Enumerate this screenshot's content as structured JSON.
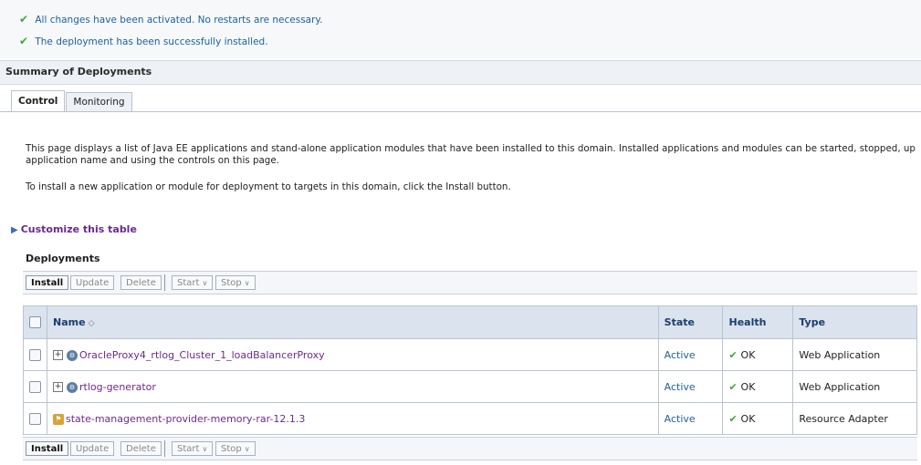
{
  "messages": [
    "All changes have been activated. No restarts are necessary.",
    "The deployment has been successfully installed."
  ],
  "summary": {
    "title": "Summary of Deployments",
    "tabs": [
      "Control",
      "Monitoring"
    ],
    "active_tab": "Control"
  },
  "description": {
    "line1": "This page displays a list of Java EE applications and stand-alone application modules that have been installed to this domain. Installed applications and modules can be started, stopped, up",
    "line1b": "application name and using the controls on this page.",
    "line2": "To install a new application or module for deployment to targets in this domain, click the Install button."
  },
  "customize": {
    "label": "Customize this table"
  },
  "deployments": {
    "title": "Deployments",
    "toolbar": {
      "install": "Install",
      "update": "Update",
      "delete": "Delete",
      "start": "Start",
      "stop": "Stop"
    },
    "columns": [
      "Name",
      "State",
      "Health",
      "Type"
    ],
    "rows": [
      {
        "name": "OracleProxy4_rtlog_Cluster_1_loadBalancerProxy",
        "state": "Active",
        "health": "OK",
        "type": "Web Application"
      },
      {
        "name": "rtlog-generator",
        "state": "Active",
        "health": "OK",
        "type": "Web Application"
      },
      {
        "name": "state-management-provider-memory-rar-12.1.3",
        "state": "Active",
        "health": "OK",
        "type": "Resource Adapter"
      }
    ]
  },
  "colors": {
    "link": "#6b2a8c",
    "state": "#1f5f9e",
    "ok_check": "#46a33c",
    "header_bg": "#dbe3ef"
  }
}
